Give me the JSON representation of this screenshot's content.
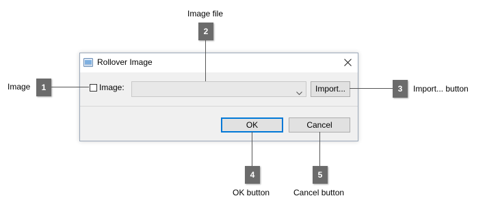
{
  "dialog": {
    "title": "Rollover Image",
    "app_icon": "window-icon",
    "close_icon": "close-icon",
    "image_checkbox_label": "Image:",
    "image_checkbox_checked": false,
    "image_file_value": "",
    "dropdown_icon": "chevron-down-icon",
    "import_button_label": "Import...",
    "ok_button_label": "OK",
    "cancel_button_label": "Cancel"
  },
  "callouts": [
    {
      "number": "1",
      "label": "Image"
    },
    {
      "number": "2",
      "label": "Image file"
    },
    {
      "number": "3",
      "label": "Import... button"
    },
    {
      "number": "4",
      "label": "OK button"
    },
    {
      "number": "5",
      "label": "Cancel button"
    }
  ],
  "colors": {
    "badge": "#6b6b6b",
    "focus_border": "#0078d7",
    "dialog_background": "#f0f0f0"
  }
}
